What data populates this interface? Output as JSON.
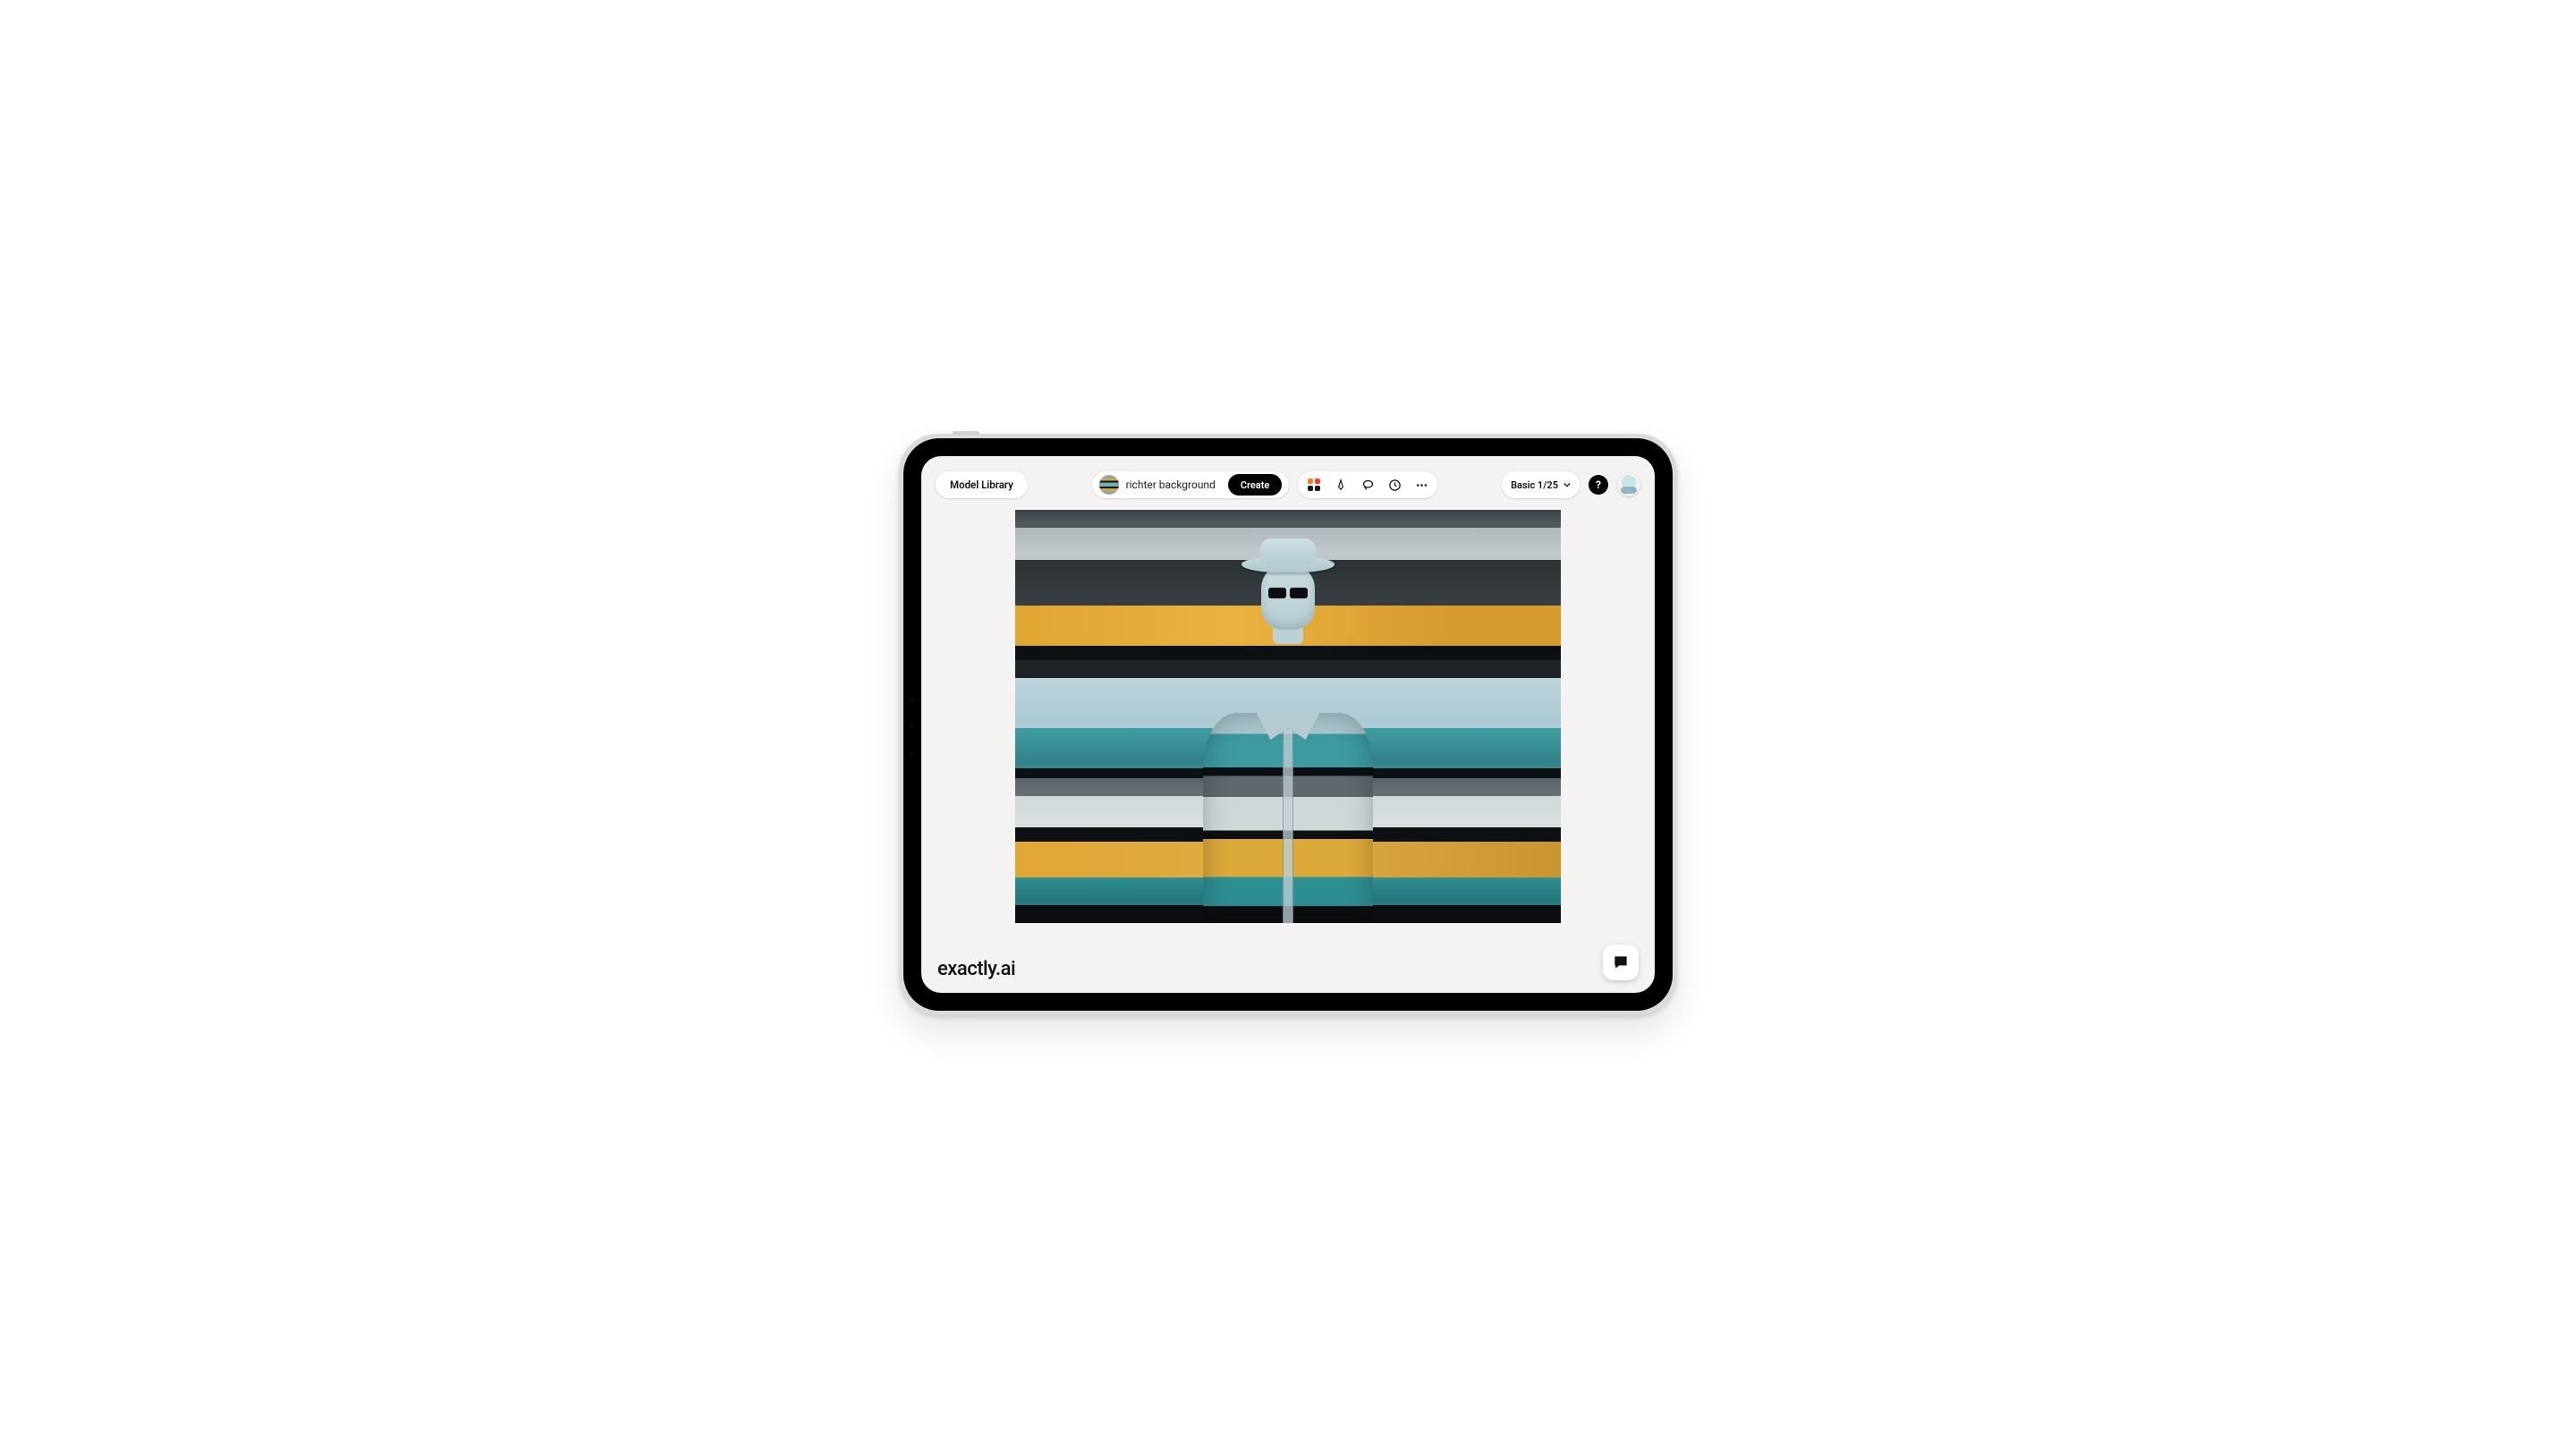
{
  "toolbar": {
    "model_library_label": "Model Library",
    "prompt_text": "richter background",
    "create_label": "Create"
  },
  "plan": {
    "label": "Basic 1/25"
  },
  "help": {
    "glyph": "?"
  },
  "brand": {
    "name": "exactly.ai"
  }
}
